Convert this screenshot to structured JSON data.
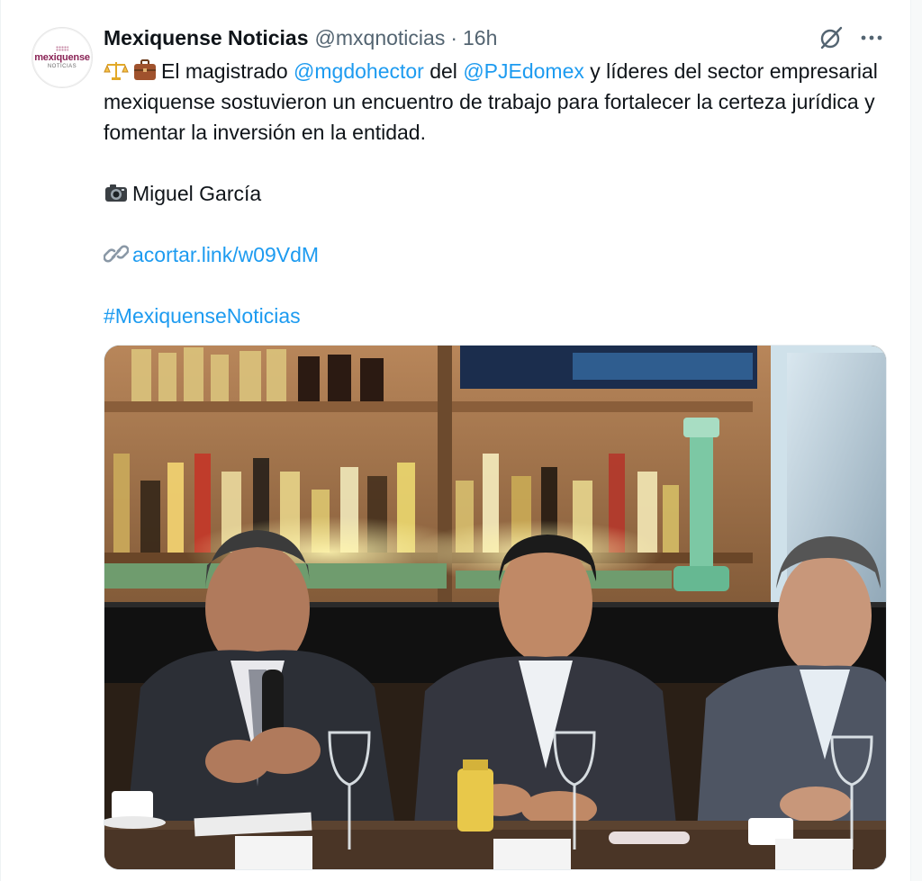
{
  "tweet": {
    "author_name": "Mexiquense Noticias",
    "handle": "@mxqnoticias",
    "separator": "·",
    "time": "16h",
    "avatar": {
      "brand_top": "mexiquense",
      "brand_bottom": "NOTICIAS"
    },
    "icons": [
      "scales-icon",
      "briefcase-icon",
      "camera-icon",
      "link-icon",
      "grok-icon",
      "more-icon"
    ],
    "body": {
      "line1_pre": "El magistrado ",
      "mention1": "@mgdohector",
      "line1_mid": " del ",
      "mention2": "@PJEdomex",
      "line1_post": " y líderes del sector empresarial mexiquense sostuvieron un encuentro de trabajo para fortalecer la certeza jurídica y fomentar la inversión en la entidad.",
      "photo_credit": "Miguel García",
      "link": "acortar.link/w09VdM",
      "hashtag": "#MexiquenseNoticias"
    }
  },
  "colors": {
    "link": "#1d9bf0",
    "text": "#0f1419",
    "muted": "#536471"
  }
}
